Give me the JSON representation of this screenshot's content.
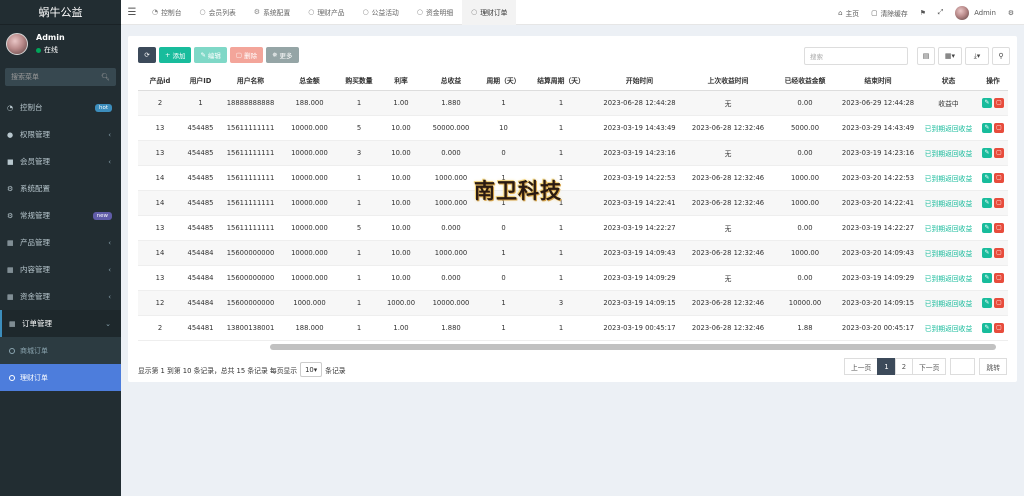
{
  "brand": "蜗牛公益",
  "user": {
    "name": "Admin",
    "status": "在线"
  },
  "sidebar": {
    "search_placeholder": "搜索菜单",
    "items": [
      {
        "label": "控制台",
        "icon": "dashboard-icon",
        "badge": "hot"
      },
      {
        "label": "权限管理",
        "icon": "users-icon"
      },
      {
        "label": "会员管理",
        "icon": "user-icon"
      },
      {
        "label": "系统配置",
        "icon": "gear-icon"
      },
      {
        "label": "常规管理",
        "icon": "cogs-icon",
        "badge": "new"
      },
      {
        "label": "产品管理",
        "icon": "file-icon"
      },
      {
        "label": "内容管理",
        "icon": "file-icon"
      },
      {
        "label": "资金管理",
        "icon": "file-icon"
      },
      {
        "label": "订单管理",
        "icon": "file-icon"
      }
    ],
    "sub_items": [
      {
        "label": "商城订单"
      },
      {
        "label": "理财订单"
      }
    ]
  },
  "topbar": {
    "tabs": [
      {
        "label": "控制台"
      },
      {
        "label": "会员列表"
      },
      {
        "label": "系统配置"
      },
      {
        "label": "理财产品"
      },
      {
        "label": "公益活动"
      },
      {
        "label": "资金明细"
      },
      {
        "label": "理财订单"
      }
    ],
    "home": "主页",
    "clear_cache": "清除缓存",
    "admin": "Admin"
  },
  "toolbar": {
    "add": "添加",
    "edit": "编辑",
    "delete": "删除",
    "more": "更多",
    "search_placeholder": "搜索"
  },
  "table": {
    "columns": [
      "产品id",
      "用户ID",
      "用户名称",
      "总金额",
      "购买数量",
      "利率",
      "总收益",
      "周期（天）",
      "结算周期（天）",
      "开始时间",
      "上次收益时间",
      "已经收益金额",
      "结束时间",
      "状态",
      "操作"
    ],
    "rows": [
      [
        "2",
        "1",
        "18888888888",
        "188.000",
        "1",
        "1.00",
        "1.880",
        "1",
        "1",
        "2023-06-28 12:44:28",
        "无",
        "0.00",
        "2023-06-29 12:44:28",
        "收益中"
      ],
      [
        "13",
        "454485",
        "15611111111",
        "10000.000",
        "5",
        "10.00",
        "50000.000",
        "10",
        "1",
        "2023-03-19 14:43:49",
        "2023-06-28 12:32:46",
        "5000.00",
        "2023-03-29 14:43:49",
        "已到期返回收益"
      ],
      [
        "13",
        "454485",
        "15611111111",
        "10000.000",
        "3",
        "10.00",
        "0.000",
        "0",
        "1",
        "2023-03-19 14:23:16",
        "无",
        "0.00",
        "2023-03-19 14:23:16",
        "已到期返回收益"
      ],
      [
        "14",
        "454485",
        "15611111111",
        "10000.000",
        "1",
        "10.00",
        "1000.000",
        "1",
        "1",
        "2023-03-19 14:22:53",
        "2023-06-28 12:32:46",
        "1000.00",
        "2023-03-20 14:22:53",
        "已到期返回收益"
      ],
      [
        "14",
        "454485",
        "15611111111",
        "10000.000",
        "1",
        "10.00",
        "1000.000",
        "1",
        "1",
        "2023-03-19 14:22:41",
        "2023-06-28 12:32:46",
        "1000.00",
        "2023-03-20 14:22:41",
        "已到期返回收益"
      ],
      [
        "13",
        "454485",
        "15611111111",
        "10000.000",
        "5",
        "10.00",
        "0.000",
        "0",
        "1",
        "2023-03-19 14:22:27",
        "无",
        "0.00",
        "2023-03-19 14:22:27",
        "已到期返回收益"
      ],
      [
        "14",
        "454484",
        "15600000000",
        "10000.000",
        "1",
        "10.00",
        "1000.000",
        "1",
        "1",
        "2023-03-19 14:09:43",
        "2023-06-28 12:32:46",
        "1000.00",
        "2023-03-20 14:09:43",
        "已到期返回收益"
      ],
      [
        "13",
        "454484",
        "15600000000",
        "10000.000",
        "1",
        "10.00",
        "0.000",
        "0",
        "1",
        "2023-03-19 14:09:29",
        "无",
        "0.00",
        "2023-03-19 14:09:29",
        "已到期返回收益"
      ],
      [
        "12",
        "454484",
        "15600000000",
        "1000.000",
        "1",
        "1000.00",
        "10000.000",
        "1",
        "3",
        "2023-03-19 14:09:15",
        "2023-06-28 12:32:46",
        "10000.00",
        "2023-03-20 14:09:15",
        "已到期返回收益"
      ],
      [
        "2",
        "454481",
        "13800138001",
        "188.000",
        "1",
        "1.00",
        "1.880",
        "1",
        "1",
        "2023-03-19 00:45:17",
        "2023-06-28 12:32:46",
        "1.88",
        "2023-03-20 00:45:17",
        "已到期返回收益"
      ]
    ]
  },
  "footer": {
    "info_prefix": "显示第 1 到第 10 条记录，总共 15 条记录 每页显示",
    "page_size": "10",
    "info_suffix": "条记录"
  },
  "pager": {
    "prev": "上一页",
    "pages": [
      "1",
      "2"
    ],
    "next": "下一页",
    "jump": "跳转"
  },
  "watermark": "南卫科技",
  "colors": {
    "sidebar_bg": "#222d32",
    "accent": "#4d7ddc",
    "success": "#18bc9c",
    "danger": "#e74c3c"
  }
}
